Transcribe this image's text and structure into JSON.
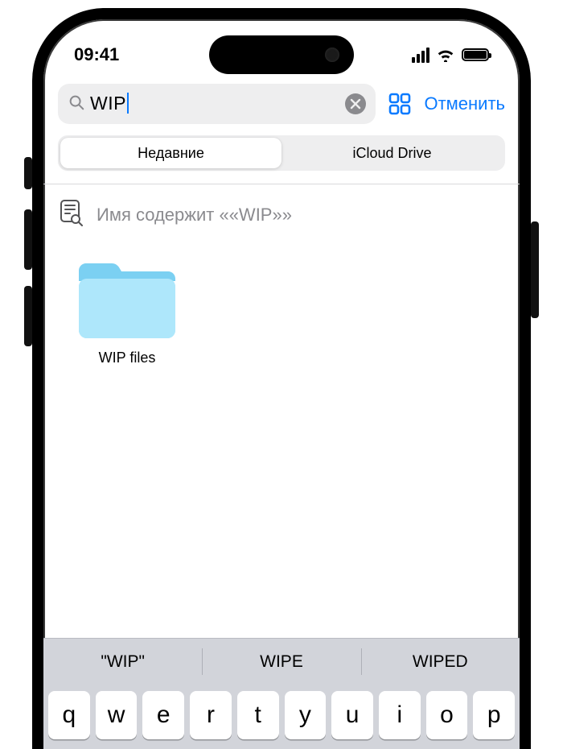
{
  "status": {
    "time": "09:41"
  },
  "search": {
    "query": "WIP",
    "cancel_label": "Отменить"
  },
  "segmented": {
    "items": [
      {
        "label": "Недавние",
        "active": true
      },
      {
        "label": "iCloud Drive",
        "active": false
      }
    ]
  },
  "filter_token": {
    "text": "Имя содержит ««WIP»»"
  },
  "results": [
    {
      "name": "WIP files",
      "type": "folder"
    }
  ],
  "keyboard": {
    "suggestions": [
      "\"WIP\"",
      "WIPE",
      "WIPED"
    ],
    "row1": [
      "q",
      "w",
      "e",
      "r",
      "t",
      "y",
      "u",
      "i",
      "o",
      "p"
    ]
  },
  "colors": {
    "accent": "#0a7aff",
    "folder": "#7bd0f2"
  }
}
